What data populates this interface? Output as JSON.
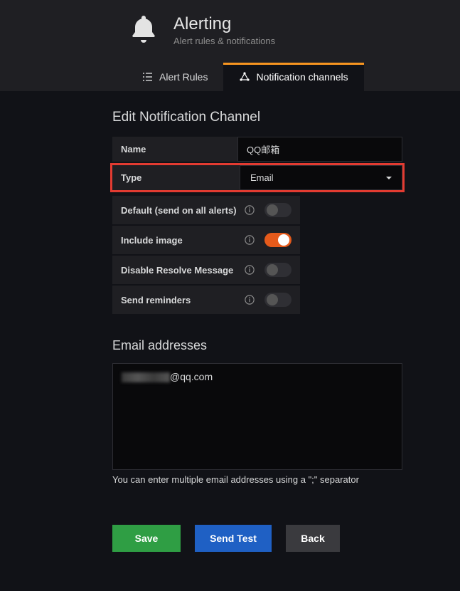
{
  "header": {
    "title": "Alerting",
    "subtitle": "Alert rules & notifications"
  },
  "tabs": {
    "alert_rules": "Alert Rules",
    "notification_channels": "Notification channels"
  },
  "form": {
    "section_title": "Edit Notification Channel",
    "name_label": "Name",
    "name_value": "QQ邮箱",
    "type_label": "Type",
    "type_value": "Email",
    "default_label": "Default (send on all alerts)",
    "include_image_label": "Include image",
    "disable_resolve_label": "Disable Resolve Message",
    "send_reminders_label": "Send reminders"
  },
  "toggles": {
    "default_on": false,
    "include_image_on": true,
    "disable_resolve_on": false,
    "send_reminders_on": false
  },
  "email": {
    "heading": "Email addresses",
    "value_suffix": "@qq.com",
    "helper": "You can enter multiple email addresses using a \";\" separator"
  },
  "buttons": {
    "save": "Save",
    "send_test": "Send Test",
    "back": "Back"
  }
}
